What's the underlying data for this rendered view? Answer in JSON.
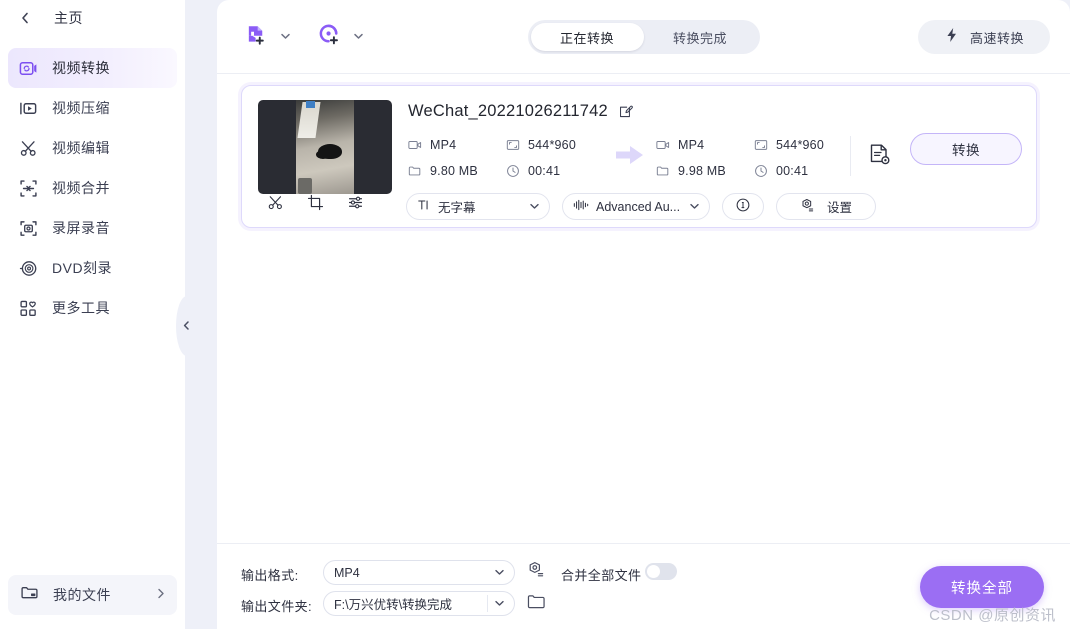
{
  "sidebar": {
    "home": {
      "label": "主页",
      "back_icon": "chevron-left-icon"
    },
    "items": [
      {
        "label": "视频转换",
        "icon": "video-convert-icon",
        "active": true
      },
      {
        "label": "视频压缩",
        "icon": "video-compress-icon",
        "active": false
      },
      {
        "label": "视频编辑",
        "icon": "scissors-icon",
        "active": false
      },
      {
        "label": "视频合并",
        "icon": "merge-icon",
        "active": false
      },
      {
        "label": "录屏录音",
        "icon": "record-screen-icon",
        "active": false
      },
      {
        "label": "DVD刻录",
        "icon": "disc-icon",
        "active": false
      },
      {
        "label": "更多工具",
        "icon": "more-tools-icon",
        "active": false
      }
    ],
    "my_files": {
      "label": "我的文件",
      "icon": "folder-icon",
      "chevron": "chevron-right-icon"
    },
    "collapse": {
      "icon": "chevron-left-icon"
    }
  },
  "toolbar": {
    "add_file": {
      "icon": "add-file-icon",
      "caret": "chevron-down-icon"
    },
    "add_dvd": {
      "icon": "add-disc-icon",
      "caret": "chevron-down-icon"
    },
    "tabs": [
      {
        "label": "正在转换",
        "selected": true
      },
      {
        "label": "转换完成",
        "selected": false
      }
    ],
    "high_speed": {
      "label": "高速转换",
      "icon": "lightning-icon"
    }
  },
  "file": {
    "name": "WeChat_20221026211742",
    "edit_icon": "edit-pencil-icon",
    "source": {
      "format": "MP4",
      "resolution": "544*960",
      "size": "9.80 MB",
      "duration": "00:41",
      "format_icon": "video-camera-icon",
      "resolution_icon": "resolution-icon",
      "size_icon": "folder-icon",
      "duration_icon": "clock-icon"
    },
    "target": {
      "format": "MP4",
      "resolution": "544*960",
      "size": "9.98 MB",
      "duration": "00:41",
      "format_icon": "video-camera-icon",
      "resolution_icon": "resolution-icon",
      "size_icon": "folder-icon",
      "duration_icon": "clock-icon"
    },
    "arrow_icon": "arrow-right-icon",
    "file_settings_icon": "file-settings-icon",
    "convert_button": "转换",
    "tools": [
      {
        "icon": "scissors-icon",
        "name": "trim-tool"
      },
      {
        "icon": "crop-icon",
        "name": "crop-tool"
      },
      {
        "icon": "effects-icon",
        "name": "effects-tool"
      }
    ],
    "subtitle_select": {
      "value": "无字幕",
      "icon": "subtitle-icon",
      "caret": "chevron-down-icon"
    },
    "audio_select": {
      "value": "Advanced Au...",
      "icon": "audio-wave-icon",
      "caret": "chevron-down-icon"
    },
    "info_button": {
      "icon": "info-icon"
    },
    "settings_button": {
      "label": "设置",
      "icon": "gear-icon"
    }
  },
  "bottom": {
    "output_format_label": "输出格式:",
    "output_format_value": "MP4",
    "output_format_caret": "chevron-down-icon",
    "format_settings_icon": "gear-list-icon",
    "output_folder_label": "输出文件夹:",
    "output_folder_value": "F:\\万兴优转\\转换完成",
    "output_folder_caret": "chevron-down-icon",
    "folder_browse_icon": "folder-open-icon",
    "merge_label": "合并全部文件",
    "merge_enabled": false,
    "convert_all_label": "转换全部"
  },
  "watermark": "CSDN @原创资讯",
  "colors": {
    "accent": "#9b6ef3",
    "accent_soft": "#ded9fb",
    "page_bg": "#eef0f8",
    "panel_bg": "#ffffff"
  }
}
